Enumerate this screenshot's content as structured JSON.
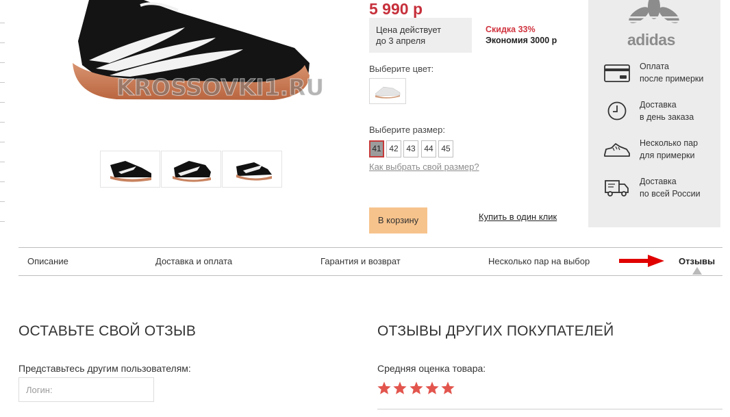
{
  "product": {
    "watermark": "KROSSOVKI1.RU",
    "thumbnails": [
      "thumb-1",
      "thumb-2",
      "thumb-3"
    ]
  },
  "price": {
    "value": "5 990 р",
    "note_line1": "Цена действует",
    "note_line2": "до 3 апреля",
    "discount": "Скидка 33%",
    "economy": "Экономия 3000 р"
  },
  "color": {
    "label": "Выберите цвет:"
  },
  "size": {
    "label": "Выберите размер:",
    "options": [
      "41",
      "42",
      "43",
      "44",
      "45"
    ],
    "selected": "41",
    "help_link": "Как выбрать свой размер?"
  },
  "actions": {
    "cart": "В корзину",
    "one_click": "Купить в один клик"
  },
  "brand": {
    "name": "adidas"
  },
  "features": [
    {
      "icon": "credit-card-icon",
      "line1": "Оплата",
      "line2": "после примерки"
    },
    {
      "icon": "clock-icon",
      "line1": "Доставка",
      "line2": "в день заказа"
    },
    {
      "icon": "sneaker-icon",
      "line1": "Несколько пар",
      "line2": "для примерки"
    },
    {
      "icon": "truck-icon",
      "line1": "Доставка",
      "line2": "по всей России"
    }
  ],
  "tabs": [
    {
      "label": "Описание"
    },
    {
      "label": "Доставка и оплата"
    },
    {
      "label": "Гарантия и возврат"
    },
    {
      "label": "Несколько пар на выбор"
    },
    {
      "label": "Отзывы",
      "active": true
    }
  ],
  "review_form": {
    "title": "ОСТАВЬТЕ СВОЙ ОТЗЫВ",
    "intro": "Представьтесь другим пользователям:",
    "login_placeholder": "Логин:"
  },
  "reviews": {
    "title": "ОТЗЫВЫ ДРУГИХ ПОКУПАТЕЛЕЙ",
    "rating_label": "Средняя оценка товара:",
    "rating": 5,
    "rating_max": 5
  },
  "colors": {
    "price": "#c6303b",
    "accent_button": "#f7c38c",
    "star": "#e2554d",
    "annotation_arrow": "#e00000"
  }
}
